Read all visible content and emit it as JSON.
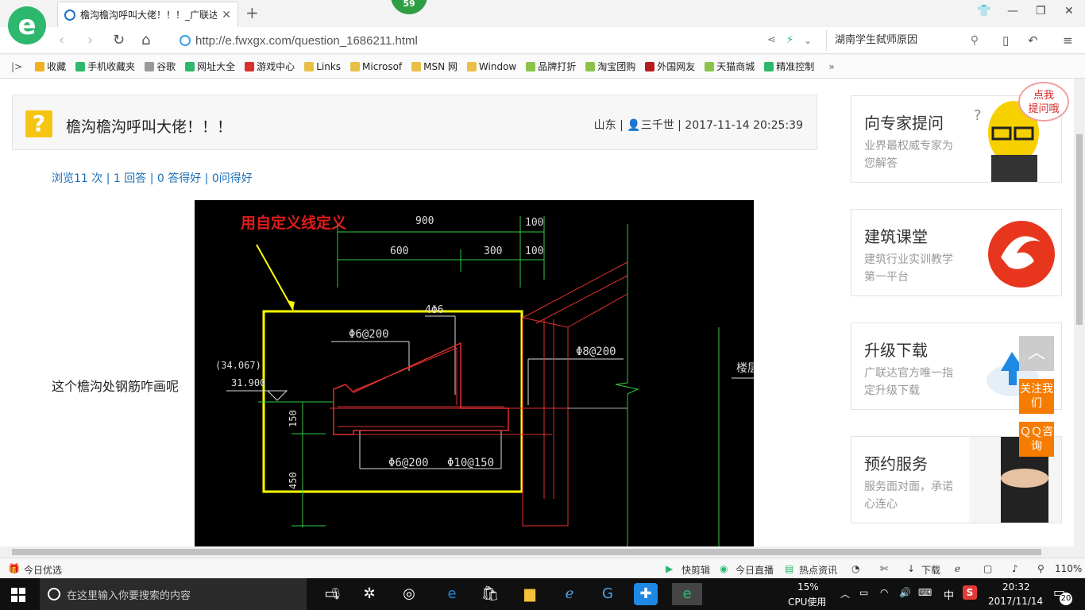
{
  "browser": {
    "tab_title": "檐沟檐沟呼叫大佬！！！_广联达",
    "badge": "59",
    "url": "http://e.fwxgx.com/question_1686211.html",
    "search_text": "湖南学生弑师原因"
  },
  "bookmarks": [
    {
      "label": "收藏",
      "color": "#f2b01e"
    },
    {
      "label": "手机收藏夹",
      "color": "#2db86e"
    },
    {
      "label": "谷歌",
      "color": "#999999"
    },
    {
      "label": "网址大全",
      "color": "#2db86e"
    },
    {
      "label": "游戏中心",
      "color": "#d9302c"
    },
    {
      "label": "Links",
      "color": "#e9c046"
    },
    {
      "label": "Microsof",
      "color": "#e9c046"
    },
    {
      "label": "MSN 网",
      "color": "#e9c046"
    },
    {
      "label": "Window",
      "color": "#e9c046"
    },
    {
      "label": "品牌打折",
      "color": "#8bc34a"
    },
    {
      "label": "淘宝团购",
      "color": "#8bc34a"
    },
    {
      "label": "外国网友",
      "color": "#b71c1c"
    },
    {
      "label": "天猫商城",
      "color": "#8bc34a"
    },
    {
      "label": "精准控制",
      "color": "#2db86e"
    }
  ],
  "question": {
    "title": "檐沟檐沟呼叫大佬！！！",
    "meta": "山东 | 👤三千世 | 2017-11-14 20:25:39",
    "stats": "浏览11 次 | 1 回答 | 0 答得好 | 0问得好",
    "body": "这个檐沟处钢筋咋画呢"
  },
  "cad": {
    "annotation": "用自定义线定义",
    "dims": {
      "d900": "900",
      "d100a": "100",
      "d600": "600",
      "d300": "300",
      "d100b": "100"
    },
    "rebar": {
      "top": "4Φ6",
      "r1": "Φ6@200",
      "r2": "Φ8@200",
      "r3": "Φ6@200",
      "r4": "Φ10@150"
    },
    "elev": {
      "e1": "(34.067)",
      "e2": "31.900"
    },
    "vdims": {
      "v150": "150",
      "v450": "450"
    },
    "floor_label": "楼层"
  },
  "sidebar": {
    "badge": "点我\n提问哦",
    "cards": [
      {
        "title": "向专家提问",
        "desc": "业界最权威专家为您解答"
      },
      {
        "title": "建筑课堂",
        "desc": "建筑行业实训教学第一平台"
      },
      {
        "title": "升级下载",
        "desc": "广联达官方唯一指定升级下载"
      },
      {
        "title": "预约服务",
        "desc": "服务面对面，承诺心连心"
      }
    ],
    "float_follow": "关注我们",
    "float_qq": "ＱＱ咨询"
  },
  "statusbar": {
    "left": "今日优选",
    "items": [
      "快剪辑",
      "今日直播",
      "热点资讯",
      "下载"
    ],
    "zoom": "110%"
  },
  "taskbar": {
    "search_placeholder": "在这里输入你要搜索的内容",
    "cpu_pct": "15%",
    "cpu_label": "CPU使用",
    "ime": "中",
    "time": "20:32",
    "date": "2017/11/14",
    "notif_count": "20"
  }
}
